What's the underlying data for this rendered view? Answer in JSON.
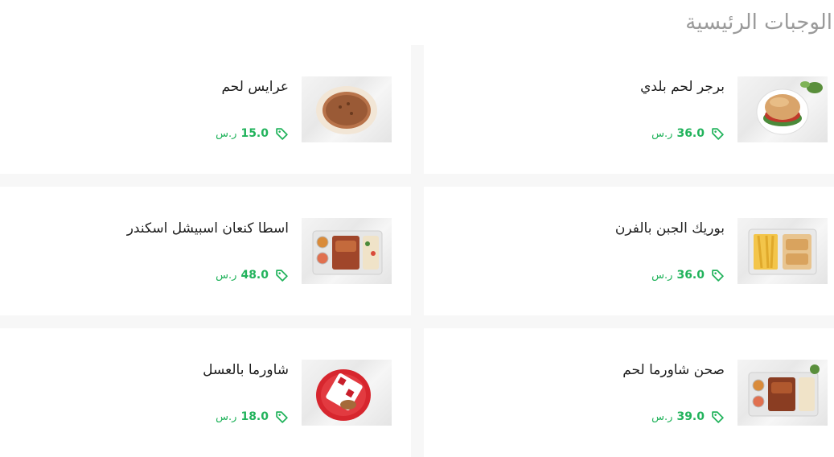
{
  "section": {
    "title": "الوجبات الرئيسية"
  },
  "colors": {
    "price_green": "#22b35c",
    "title_gray": "#9a9a9a",
    "text_dark": "#1e1e1e"
  },
  "items": [
    {
      "name": "برجر لحم بلدي",
      "price": "36.0",
      "currency": "ر.س",
      "image_icon": "burger-plate-icon"
    },
    {
      "name": "عرايس لحم",
      "price": "15.0",
      "currency": "ر.س",
      "image_icon": "arayes-pizza-icon"
    },
    {
      "name": "بوريك الجبن بالفرن",
      "price": "36.0",
      "currency": "ر.س",
      "image_icon": "borek-fries-tray-icon"
    },
    {
      "name": "اسطا كنعان اسبيشل اسكندر",
      "price": "48.0",
      "currency": "ر.س",
      "image_icon": "iskender-tray-icon"
    },
    {
      "name": "صحن شاورما لحم",
      "price": "39.0",
      "currency": "ر.س",
      "image_icon": "shawarma-plate-icon"
    },
    {
      "name": "شاورما بالعسل",
      "price": "18.0",
      "currency": "ر.س",
      "image_icon": "honey-shawarma-wrap-icon"
    }
  ]
}
